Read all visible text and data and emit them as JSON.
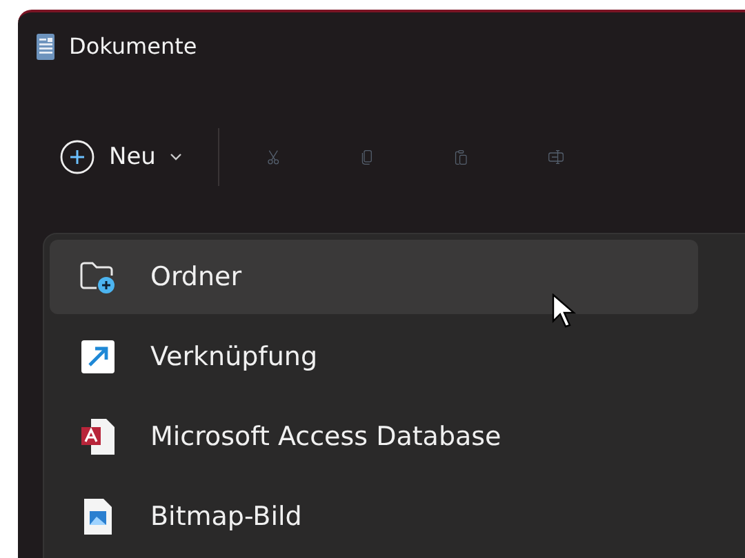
{
  "window": {
    "title": "Dokumente"
  },
  "toolbar": {
    "new_button": {
      "label": "Neu"
    },
    "tools": [
      {
        "kind": "cut",
        "disabled": true
      },
      {
        "kind": "copy",
        "disabled": true
      },
      {
        "kind": "paste",
        "disabled": true
      },
      {
        "kind": "rename",
        "disabled": true
      }
    ]
  },
  "new_menu": {
    "items": [
      {
        "kind": "folder",
        "label": "Ordner",
        "selected": true
      },
      {
        "kind": "shortcut",
        "label": "Verknüpfung",
        "selected": false
      },
      {
        "kind": "access",
        "label": "Microsoft Access Database",
        "selected": false
      },
      {
        "kind": "bitmap",
        "label": "Bitmap-Bild",
        "selected": false
      }
    ]
  }
}
